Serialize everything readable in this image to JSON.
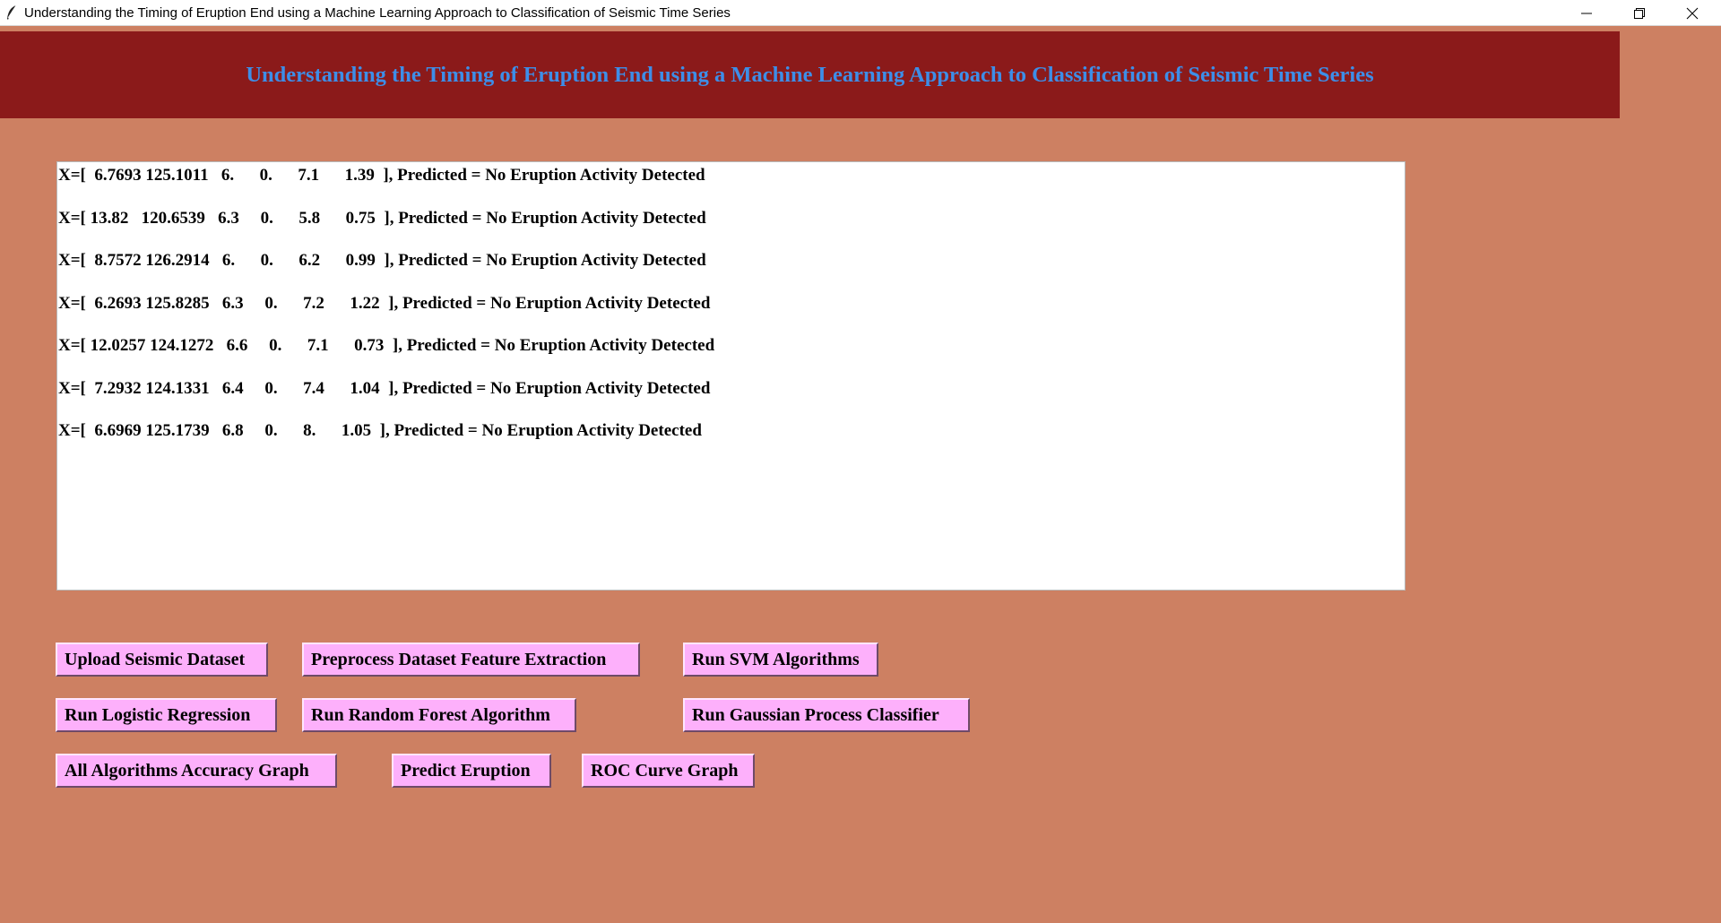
{
  "window": {
    "title": "Understanding the Timing of Eruption End using a Machine Learning Approach to Classification of Seismic Time Series",
    "icon": "feather-icon"
  },
  "header": {
    "title": "Understanding the Timing of Eruption End using a Machine Learning Approach to Classification of Seismic Time Series",
    "background_color": "#8b1a1a",
    "text_color": "#3d8ee8"
  },
  "output": {
    "lines": [
      "X=[  6.7693 125.1011   6.      0.      7.1      1.39  ], Predicted = No Eruption Activity Detected",
      "X=[ 13.82   120.6539   6.3     0.      5.8      0.75  ], Predicted = No Eruption Activity Detected",
      "X=[  8.7572 126.2914   6.      0.      6.2      0.99  ], Predicted = No Eruption Activity Detected",
      "X=[  6.2693 125.8285   6.3     0.      7.2      1.22  ], Predicted = No Eruption Activity Detected",
      "X=[ 12.0257 124.1272   6.6     0.      7.1      0.73  ], Predicted = No Eruption Activity Detected",
      "X=[  7.2932 124.1331   6.4     0.      7.4      1.04  ], Predicted = No Eruption Activity Detected",
      "X=[  6.6969 125.1739   6.8     0.      8.      1.05  ], Predicted = No Eruption Activity Detected"
    ]
  },
  "buttons": {
    "upload": "Upload Seismic Dataset",
    "preprocess": "Preprocess Dataset Feature Extraction",
    "svm": "Run SVM Algorithms",
    "logistic": "Run Logistic Regression",
    "random_forest": "Run Random Forest Algorithm",
    "gaussian": "Run Gaussian Process Classifier",
    "accuracy_graph": "All Algorithms Accuracy Graph",
    "predict": "Predict Eruption",
    "roc": "ROC Curve Graph"
  },
  "colors": {
    "background": "#cd8062",
    "button": "#fdb0fb"
  }
}
